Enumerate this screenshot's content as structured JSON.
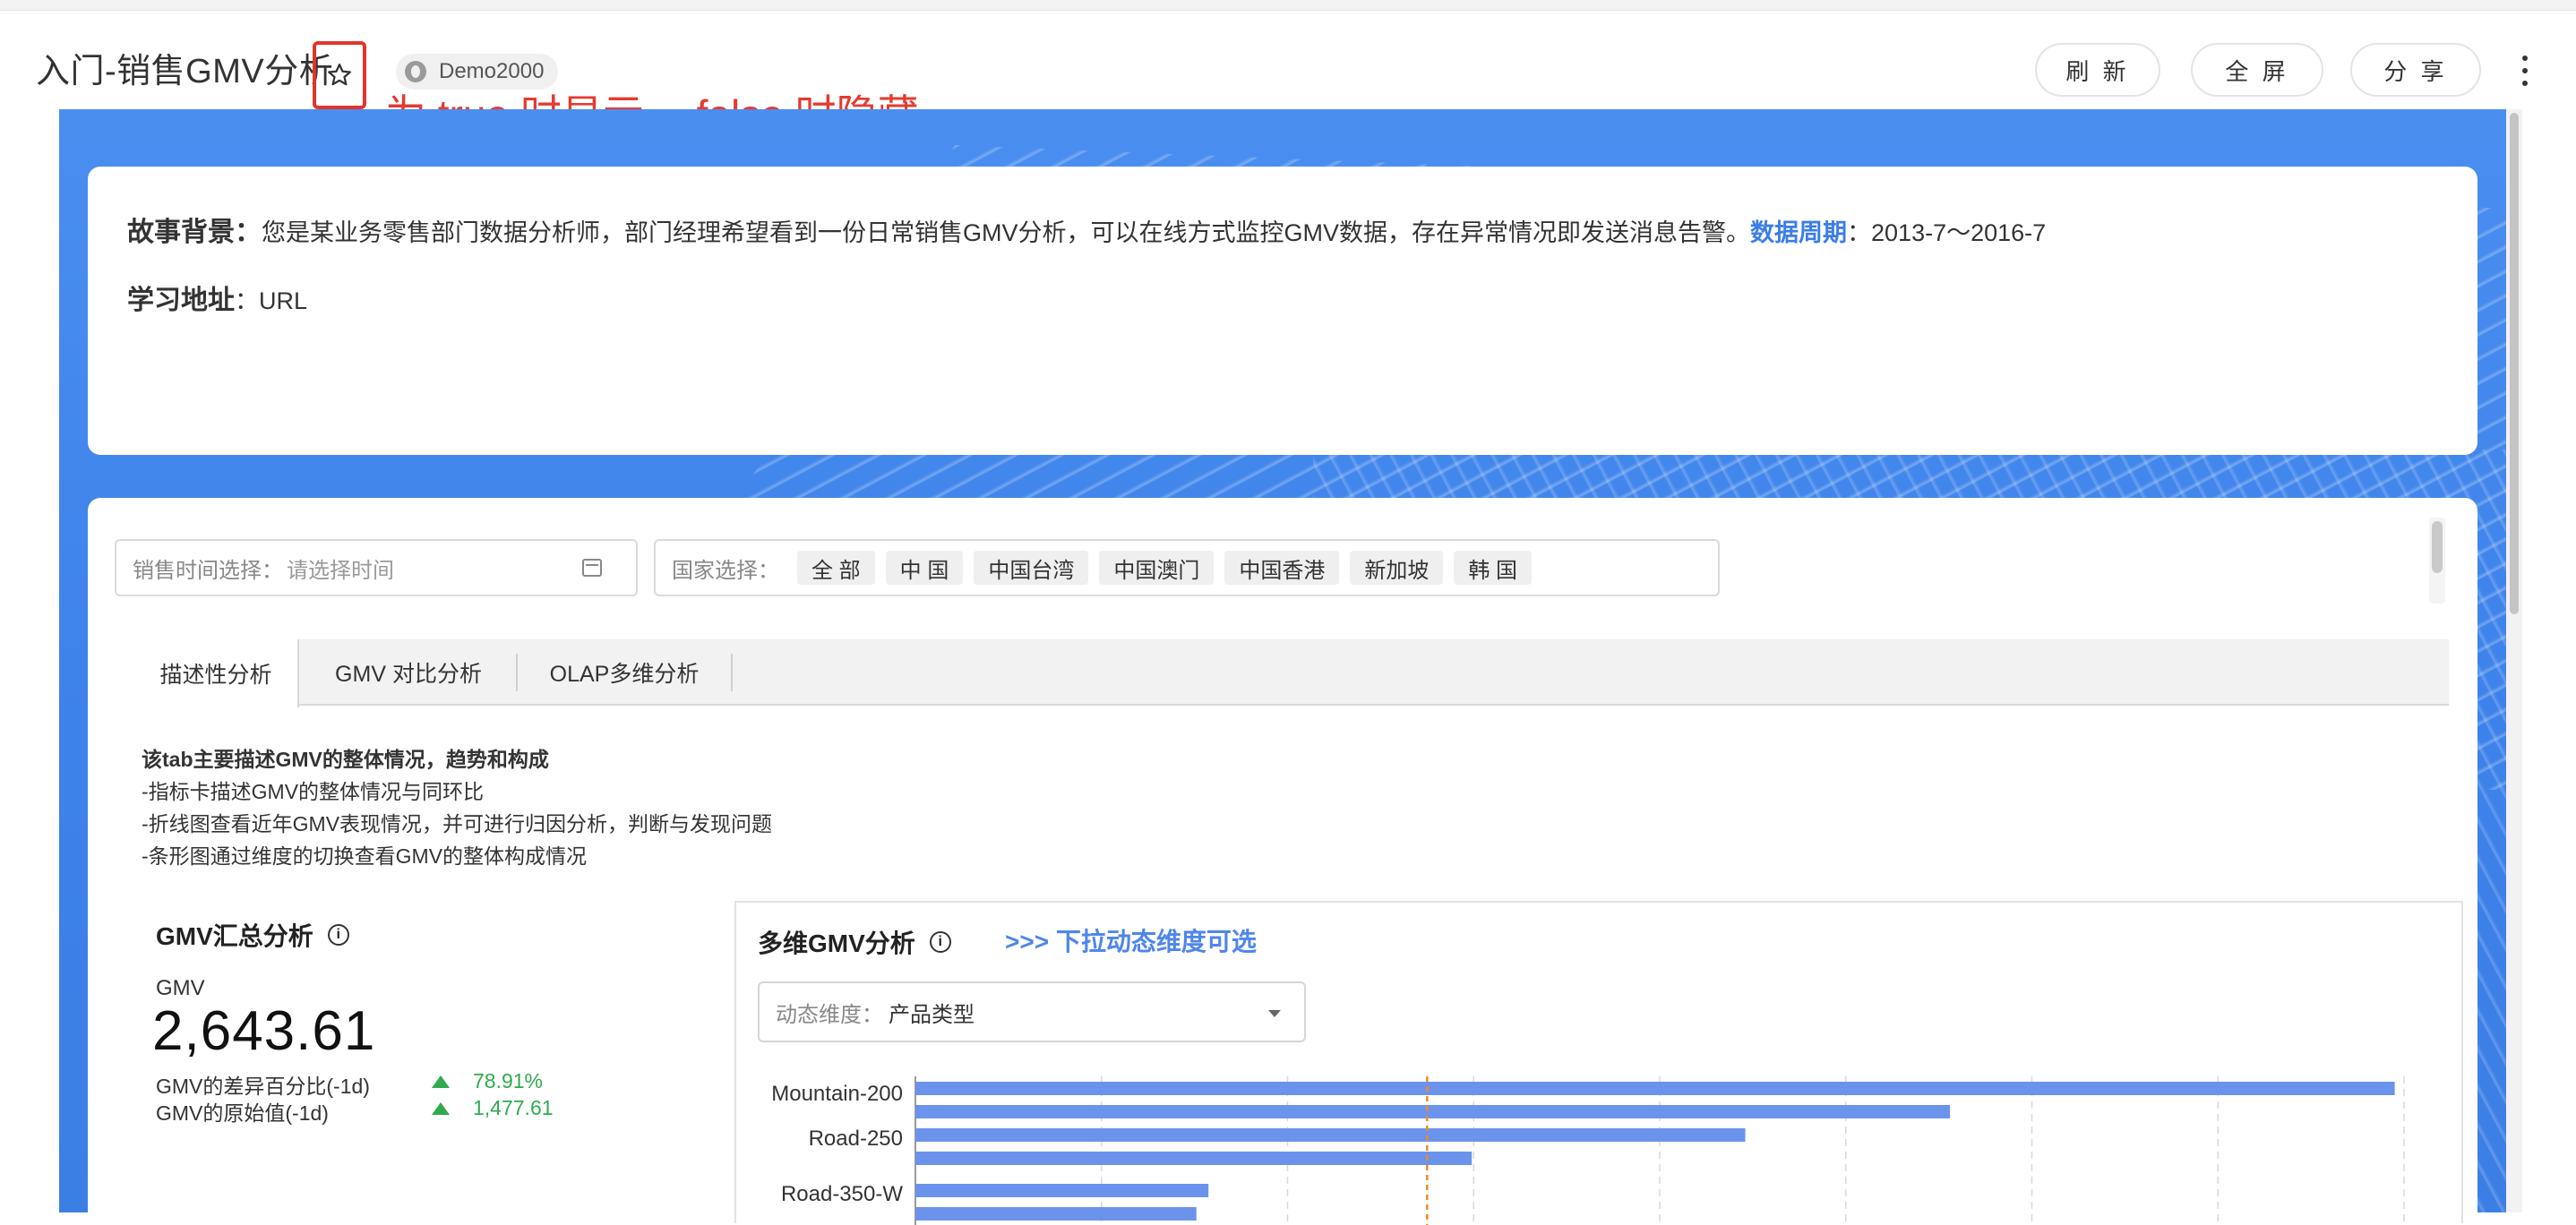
{
  "header": {
    "title": "入门-销售GMV分析",
    "owner": "Demo2000",
    "annotation": "为 true 时显示， false 时隐藏",
    "buttons": {
      "refresh": "刷 新",
      "fullscreen": "全 屏",
      "share": "分 享"
    }
  },
  "story": {
    "bg_label": "故事背景",
    "bg_sep": "：",
    "bg_text": "您是某业务零售部门数据分析师，部门经理希望看到一份日常销售GMV分析，可以在线方式监控GMV数据，存在异常情况即发送消息告警。",
    "period_label": "数据周期",
    "period_value": "：2013-7～2016-7",
    "learn_label": "学习地址",
    "learn_value": "：URL"
  },
  "filters": {
    "time_label": "销售时间选择：",
    "time_placeholder": "请选择时间",
    "country_label": "国家选择：",
    "countries": [
      "全 部",
      "中 国",
      "中国台湾",
      "中国澳门",
      "中国香港",
      "新加坡",
      "韩 国"
    ]
  },
  "tabs": [
    "描述性分析",
    "GMV 对比分析",
    "OLAP多维分析"
  ],
  "description": {
    "heading": "该tab主要描述GMV的整体情况，趋势和构成",
    "lines": [
      "-指标卡描述GMV的整体情况与同环比",
      "-折线图查看近年GMV表现情况，并可进行归因分析，判断与发现问题",
      "-条形图通过维度的切换查看GMV的整体构成情况"
    ]
  },
  "kpi": {
    "title": "GMV汇总分析",
    "metric_label": "GMV",
    "value": "2,643.61",
    "row1_label": "GMV的差异百分比(-1d)",
    "row1_value": "78.91%",
    "row2_label": "GMV的原始值(-1d)",
    "row2_value": "1,477.61"
  },
  "panel": {
    "title": "多维GMV分析",
    "hint": ">>> 下拉动态维度可选",
    "dim_label": "动态维度：",
    "dim_value": "产品类型"
  },
  "colors": {
    "accent": "#4e86ea",
    "bar": "#6b93ec",
    "ref_line": "#f08a24",
    "up": "#2faa4f",
    "annotation": "#e53a2f"
  },
  "chart_data": {
    "type": "bar",
    "orientation": "horizontal",
    "categories": [
      "Mountain-200",
      "",
      "Road-250",
      "",
      "Road-350-W",
      ""
    ],
    "values": [
      1590,
      1112,
      892,
      598,
      315,
      302
    ],
    "xlim": [
      0,
      1600
    ],
    "reference_line": 550
  }
}
